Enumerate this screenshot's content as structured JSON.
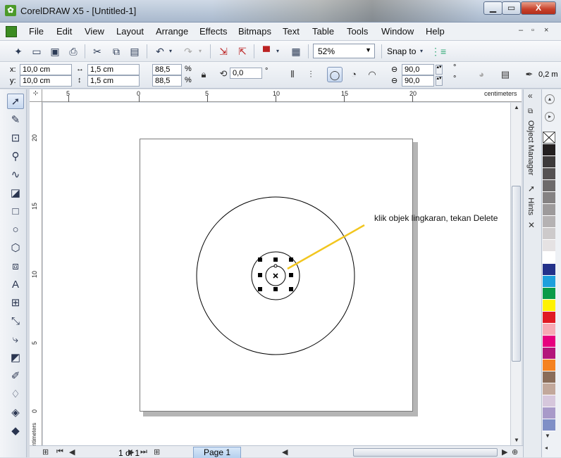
{
  "window": {
    "title": "CorelDRAW X5 - [Untitled-1]",
    "min_label": "▁",
    "max_label": "▭",
    "close_label": "X"
  },
  "menu": {
    "items": [
      "File",
      "Edit",
      "View",
      "Layout",
      "Arrange",
      "Effects",
      "Bitmaps",
      "Text",
      "Table",
      "Tools",
      "Window",
      "Help"
    ],
    "mdi": [
      "–",
      "▫",
      "×"
    ]
  },
  "toolbar": {
    "zoom": "52%",
    "snap_label": "Snap to"
  },
  "propbar": {
    "x_label": "x:",
    "x_value": "10,0 cm",
    "y_label": "y:",
    "y_value": "10,0 cm",
    "w_value": "1,5 cm",
    "h_value": "1,5 cm",
    "scale_x": "88,5",
    "scale_y": "88,5",
    "percent": "%",
    "rotation": "0,0",
    "degree": "°",
    "start_angle": "90,0",
    "end_angle": "90,0",
    "outline": "0,2 m"
  },
  "rulers": {
    "top_unit": "centimeters",
    "left_unit": "centimeters",
    "top_labels": [
      "5",
      "0",
      "5",
      "10",
      "15",
      "20"
    ],
    "left_labels": [
      "20",
      "15",
      "10",
      "5",
      "0"
    ]
  },
  "canvas": {
    "annotation": "klik objek lingkaran, tekan Delete",
    "annotation_color": "#f2c61f",
    "page_bg": "#ffffff"
  },
  "statusbar": {
    "page_count": "1 of 1",
    "page_tab": "Page 1"
  },
  "dockers": {
    "object_manager": "Object Manager",
    "hints": "Hints"
  },
  "palette": {
    "colors": [
      "#231f20",
      "#3d3a3b",
      "#555253",
      "#6d6a6b",
      "#858283",
      "#9d9a9b",
      "#b5b2b3",
      "#cdcacb",
      "#e5e2e3",
      "#ffffff",
      "#23318a",
      "#1ea0dc",
      "#0a9b48",
      "#fff200",
      "#e01b24",
      "#f7a9b4",
      "#e6007e",
      "#b3157a",
      "#f58220",
      "#8a6d5a",
      "#c2a89b",
      "#d6c7dc",
      "#a89ac9",
      "#7f8fc6"
    ]
  }
}
